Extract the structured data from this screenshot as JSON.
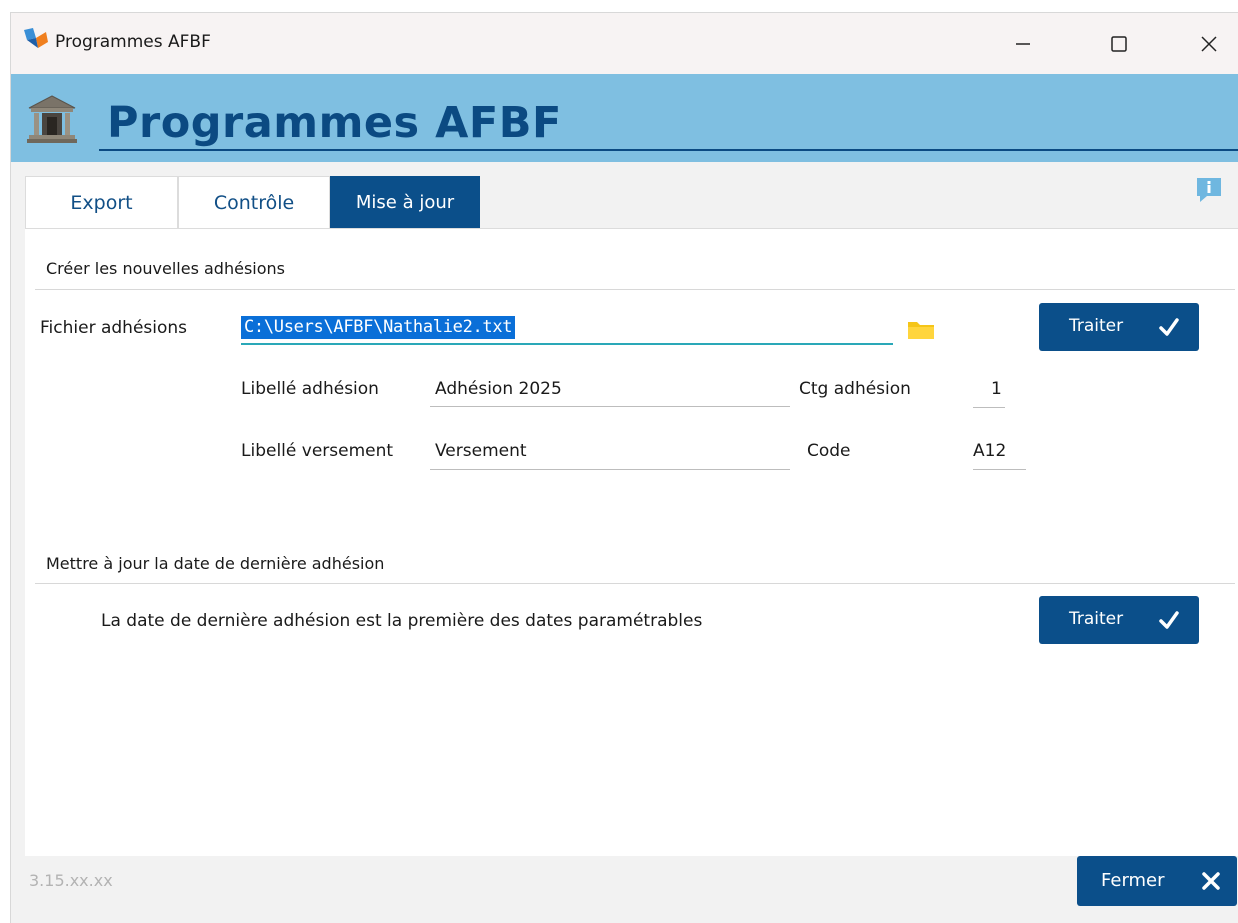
{
  "window": {
    "title": "Programmes AFBF",
    "controls": {
      "minimize": "—",
      "maximize": "☐",
      "close": "✕"
    }
  },
  "header": {
    "title": "Programmes AFBF",
    "icon": "bank-icon"
  },
  "tabs": [
    {
      "label": "Export",
      "active": false
    },
    {
      "label": "Contrôle",
      "active": false
    },
    {
      "label": "Mise à jour",
      "active": true
    }
  ],
  "info_icon": "info-icon",
  "section_create": {
    "title": "Créer les nouvelles adhésions",
    "file_label": "Fichier adhésions",
    "file_value": "C:\\Users\\AFBF\\Nathalie2.txt",
    "folder_icon": "folder-icon",
    "libelle_adhesion_label": "Libellé adhésion",
    "libelle_adhesion_value": "Adhésion 2025",
    "ctg_adhesion_label": "Ctg adhésion",
    "ctg_adhesion_value": "1",
    "libelle_versement_label": "Libellé versement",
    "libelle_versement_value": "Versement",
    "code_label": "Code",
    "code_value": "A12",
    "button_label": "Traiter"
  },
  "section_update": {
    "title": "Mettre à jour la date de dernière adhésion",
    "description": "La date de dernière adhésion est la première des dates paramétrables",
    "button_label": "Traiter"
  },
  "footer": {
    "version": "3.15.xx.xx",
    "close_label": "Fermer"
  },
  "colors": {
    "accent": "#0b4f8a",
    "header_band": "#7fbfe1",
    "selection": "#0a6fd8",
    "folder": "#f5c518"
  }
}
